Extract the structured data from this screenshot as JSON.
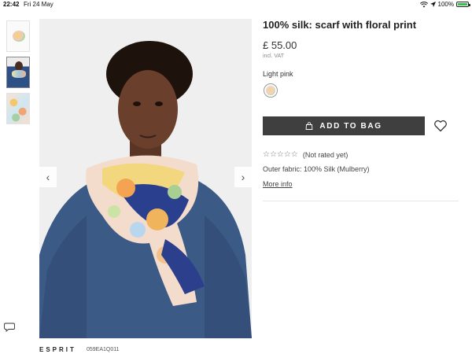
{
  "status_bar": {
    "time": "22:42",
    "date": "Fri 24 May",
    "battery": "100%",
    "battery_level": 1.0
  },
  "product": {
    "title": "100% silk: scarf with floral print",
    "price": "£ 55.00",
    "vat_note": "incl. VAT",
    "color_name": "Light pink",
    "add_to_bag_label": "ADD TO BAG",
    "rating_text": "(Not rated yet)",
    "rating_stars": "☆☆☆☆☆",
    "fabric": "Outer fabric: 100% Silk (Mulberry)",
    "more_info_label": "More info"
  },
  "gallery": {
    "thumbnails": [
      "scarf-product-image",
      "model-wearing-scarf",
      "scarf-floral-detail"
    ],
    "selected_index": 1,
    "prev_arrow": "‹",
    "next_arrow": "›"
  },
  "footer": {
    "brand": "ESPRIT",
    "sku": "059EA1Q011"
  },
  "icons": {
    "wifi": "wifi-icon",
    "location": "location-icon",
    "bag": "bag-icon",
    "heart": "heart-icon",
    "chat": "chat-icon"
  },
  "colors": {
    "button_bg": "#3f3f3f",
    "battery_fill": "#39c34a"
  }
}
